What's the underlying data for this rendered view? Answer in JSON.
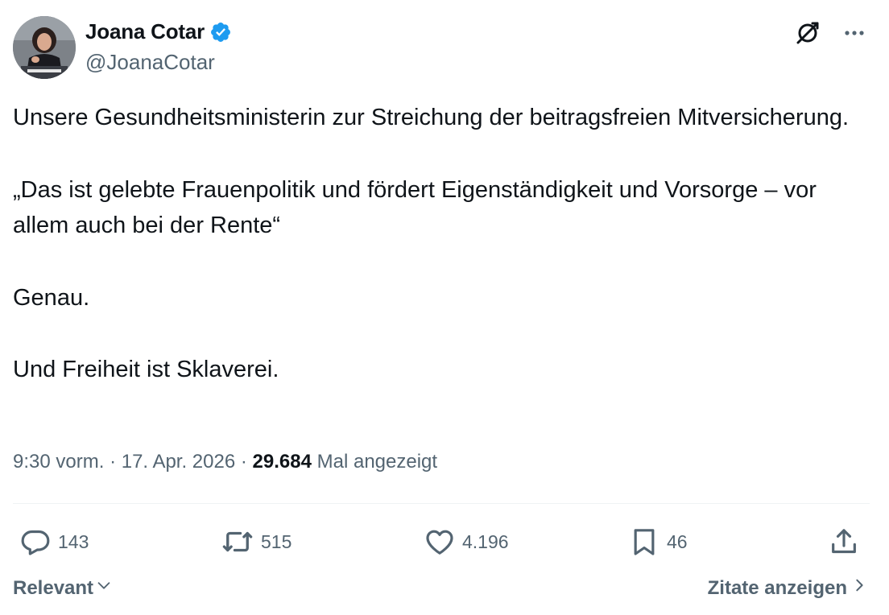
{
  "author": {
    "display_name": "Joana Cotar",
    "handle": "@JoanaCotar",
    "verified": true,
    "verified_color": "#1d9bf0",
    "avatar_caption": "Joana Cotar, Fraktionslos"
  },
  "header_icons": [
    "grok-icon",
    "more-icon"
  ],
  "tweet": {
    "paragraphs": [
      "Unsere Gesundheitsministerin zur Streichung der beitragsfreien Mitversicherung.",
      "„Das ist gelebte Frauenpolitik und fördert Eigenständigkeit und Vorsorge – vor allem auch bei der Rente“",
      "Genau.",
      "Und Freiheit ist Sklaverei."
    ]
  },
  "meta": {
    "time": "9:30 vorm.",
    "separator": "·",
    "date": "17. Apr. 2026",
    "views_count": "29.684",
    "views_label": "Mal angezeigt"
  },
  "actions": {
    "replies": "143",
    "reposts": "515",
    "likes": "4.196",
    "bookmarks": "46"
  },
  "footer": {
    "sort_label": "Relevant",
    "quotes_label": "Zitate anzeigen"
  },
  "colors": {
    "text_primary": "#0f1419",
    "text_secondary": "#536471",
    "divider": "#eff3f4",
    "accent": "#1d9bf0"
  }
}
